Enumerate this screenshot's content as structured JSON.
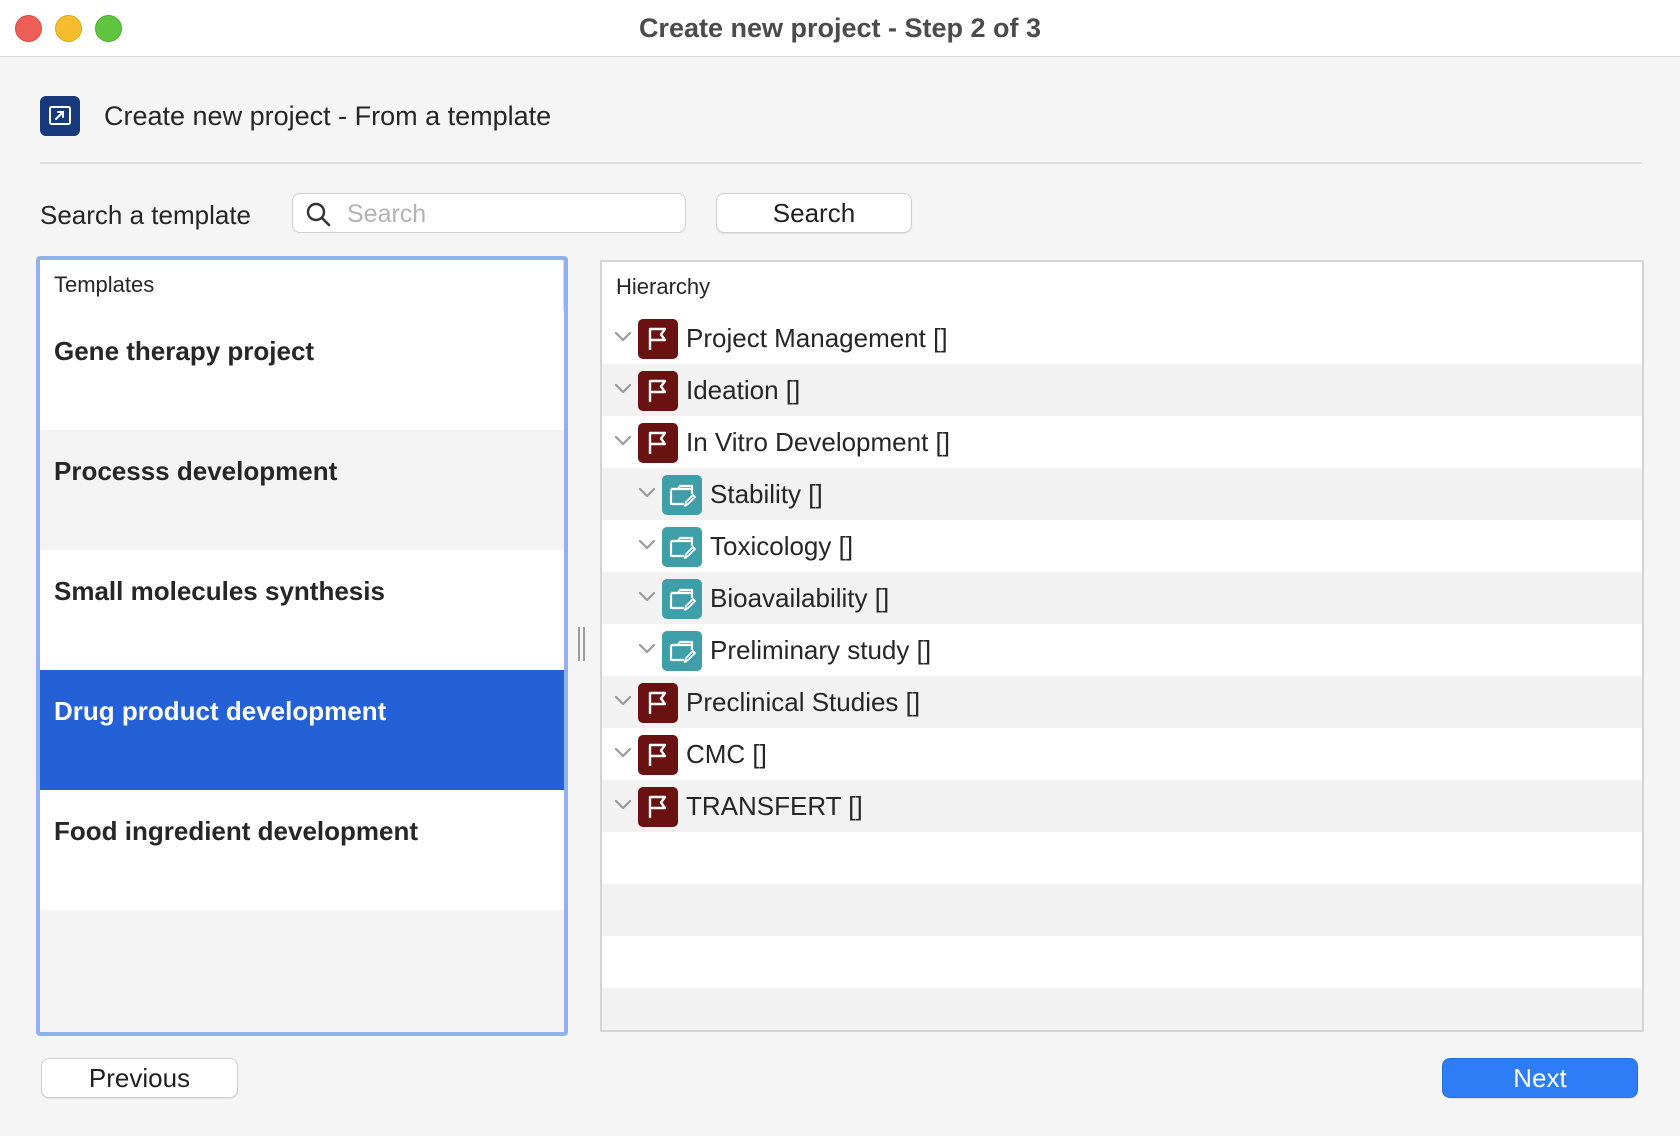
{
  "window": {
    "title": "Create new project - Step 2 of 3"
  },
  "header": {
    "title": "Create new project - From a template",
    "icon": "project-template-icon"
  },
  "search": {
    "label": "Search a template",
    "placeholder": "Search",
    "value": "",
    "button_label": "Search"
  },
  "templates": {
    "header": "Templates",
    "selected": "Drug product development",
    "items": [
      {
        "label": "Gene therapy project"
      },
      {
        "label": "Processs development"
      },
      {
        "label": "Small molecules synthesis"
      },
      {
        "label": "Drug product development"
      },
      {
        "label": "Food ingredient development"
      }
    ]
  },
  "hierarchy": {
    "header": "Hierarchy",
    "nodes": [
      {
        "label": "Project Management []",
        "level": 0,
        "icon": "flag-icon"
      },
      {
        "label": "Ideation []",
        "level": 0,
        "icon": "flag-icon"
      },
      {
        "label": "In Vitro Development []",
        "level": 0,
        "icon": "flag-icon"
      },
      {
        "label": "Stability []",
        "level": 1,
        "icon": "folder-edit-icon"
      },
      {
        "label": "Toxicology []",
        "level": 1,
        "icon": "folder-edit-icon"
      },
      {
        "label": "Bioavailability []",
        "level": 1,
        "icon": "folder-edit-icon"
      },
      {
        "label": "Preliminary study []",
        "level": 1,
        "icon": "folder-edit-icon"
      },
      {
        "label": "Preclinical Studies []",
        "level": 0,
        "icon": "flag-icon"
      },
      {
        "label": "CMC []",
        "level": 0,
        "icon": "flag-icon"
      },
      {
        "label": "TRANSFERT []",
        "level": 0,
        "icon": "flag-icon"
      }
    ]
  },
  "footer": {
    "previous_label": "Previous",
    "next_label": "Next"
  },
  "colors": {
    "accent": "#2e7cf6",
    "selection": "#2561d6",
    "flag_icon_bg": "#6a1111",
    "folder_icon_bg": "#3e9fa9"
  }
}
